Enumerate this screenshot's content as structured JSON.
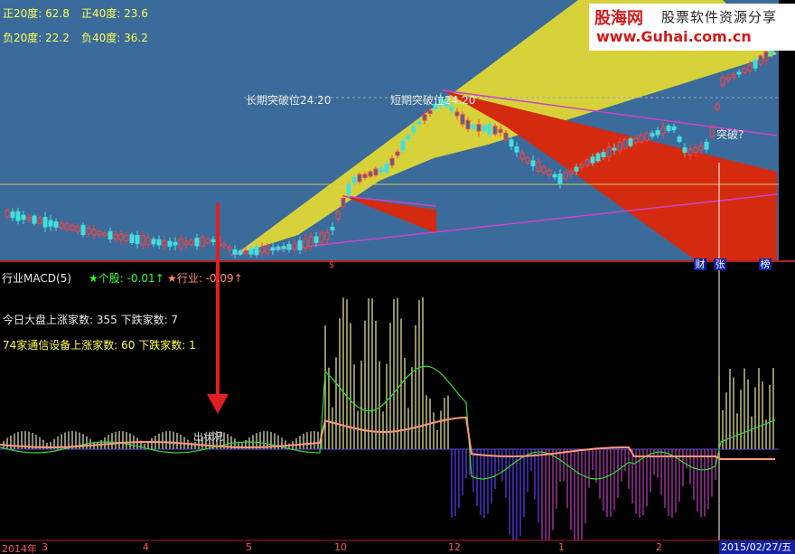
{
  "top_panel": {
    "pos20_label": "正20度:",
    "pos20_value": "62.8",
    "pos40_label": "正40度:",
    "pos40_value": "23.6",
    "neg20_label": "负20度:",
    "neg20_value": "22.2",
    "neg40_label": "负40度:",
    "neg40_value": "36.2",
    "long_breakout": "长期突破位24.20",
    "short_breakout": "短期突破位24.20",
    "breakout_q": "突破?",
    "events": [
      "财",
      "张",
      "榜"
    ],
    "marker_s": "$"
  },
  "watermark": {
    "logo": "股海网",
    "slogan": "股票软件资源分享",
    "url": "www.Guhai.com.cn"
  },
  "bottom_panel": {
    "indicator_title": "行业MACD(5)",
    "stock_label": "★个股:",
    "stock_value": "-0.01↑",
    "industry_label": "★行业:",
    "industry_value": "-0.09↑",
    "market_line": "今日大盘上涨家数: 355 下跌家数: 7",
    "sector_line": "74家通信设备上涨家数: 60 下跌家数: 1",
    "annotation": "出状况"
  },
  "x_axis": {
    "labels": [
      "2014年",
      "3",
      "4",
      "5",
      "10",
      "12",
      "1",
      "2"
    ],
    "current_date": "2015/02/27/五"
  },
  "colors": {
    "top_bg": "#3b6b9a",
    "bottom_bg": "#000000",
    "yellow_fan": "#d8d23a",
    "red_fan": "#d42a10",
    "magenta_line": "#cc44cc",
    "arrow": "#e02020"
  }
}
